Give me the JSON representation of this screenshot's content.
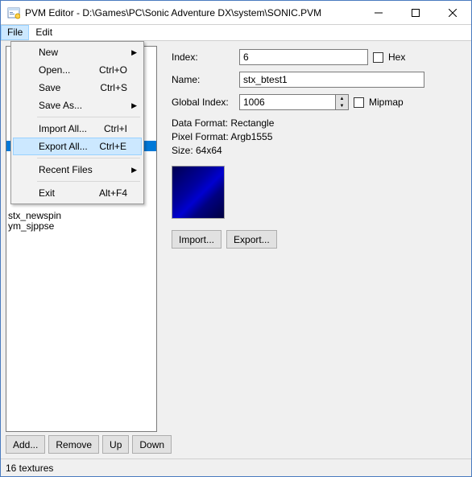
{
  "window": {
    "title": "PVM Editor - D:\\Games\\PC\\Sonic Adventure DX\\system\\SONIC.PVM"
  },
  "menubar": {
    "file": "File",
    "edit": "Edit"
  },
  "menu": {
    "new": "New",
    "open": "Open...",
    "open_sc": "Ctrl+O",
    "save": "Save",
    "save_sc": "Ctrl+S",
    "saveas": "Save As...",
    "importall": "Import All...",
    "importall_sc": "Ctrl+I",
    "exportall": "Export All...",
    "exportall_sc": "Ctrl+E",
    "recent": "Recent Files",
    "exit": "Exit",
    "exit_sc": "Alt+F4"
  },
  "list": {
    "visible": [
      "stx_newspin",
      "ym_sjppse"
    ]
  },
  "buttons": {
    "add": "Add...",
    "remove": "Remove",
    "up": "Up",
    "down": "Down",
    "import": "Import...",
    "export": "Export..."
  },
  "props": {
    "index_lbl": "Index:",
    "index_val": "6",
    "hex": "Hex",
    "name_lbl": "Name:",
    "name_val": "stx_btest1",
    "gindex_lbl": "Global Index:",
    "gindex_val": "1006",
    "mipmap": "Mipmap",
    "dataformat": "Data Format: Rectangle",
    "pixelformat": "Pixel Format: Argb1555",
    "size": "Size: 64x64"
  },
  "status": "16 textures"
}
